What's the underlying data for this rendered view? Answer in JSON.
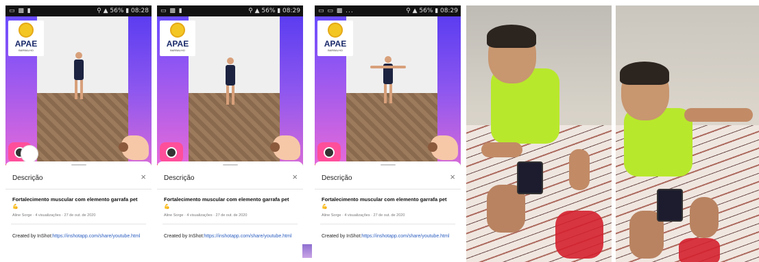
{
  "panels": [
    {
      "status": {
        "left": "▭ ▩ ▮",
        "right": "⚲ ▲ 56% ▮ 08:28"
      },
      "logo": {
        "text": "APAE",
        "sub": "BARBALHO"
      },
      "sheet": {
        "title": "Descrição",
        "video_title": "Fortalecimento muscular com elemento garrafa pet",
        "emoji": "💪",
        "meta": "Aline Sorge · 4 visualizações · 27 de out. de 2020",
        "desc_prefix": "Created by InShot:",
        "desc_link": "https://inshotapp.com/share/youtube.html"
      }
    },
    {
      "status": {
        "left": "▭ ▩ ▮",
        "right": "⚲ ▲ 56% ▮ 08:29"
      },
      "logo": {
        "text": "APAE",
        "sub": "BARBALHO"
      },
      "sheet": {
        "title": "Descrição",
        "video_title": "Fortalecimento muscular com elemento garrafa pet",
        "emoji": "💪",
        "meta": "Aline Sorge · 4 visualizações · 27 de out. de 2020",
        "desc_prefix": "Created by InShot:",
        "desc_link": "https://inshotapp.com/share/youtube.html"
      }
    },
    {
      "status": {
        "left": "▭ ▭ ▩ ...",
        "right": "⚲ ▲ 56% ▮ 08:29"
      },
      "logo": {
        "text": "APAE",
        "sub": "BARBALHO"
      },
      "sheet": {
        "title": "Descrição",
        "video_title": "Fortalecimento muscular com elemento garrafa pet",
        "emoji": "💪",
        "meta": "Aline Sorge · 4 visualizações · 27 de out. de 2020",
        "desc_prefix": "Created by InShot:",
        "desc_link": "https://inshotapp.com/share/youtube.html"
      }
    }
  ],
  "icons": {
    "close": "×"
  },
  "colors": {
    "accent_pink": "#ff4f9a",
    "link": "#2a5dbf",
    "progress": "#e53935",
    "shirt": "#b8e82c"
  }
}
